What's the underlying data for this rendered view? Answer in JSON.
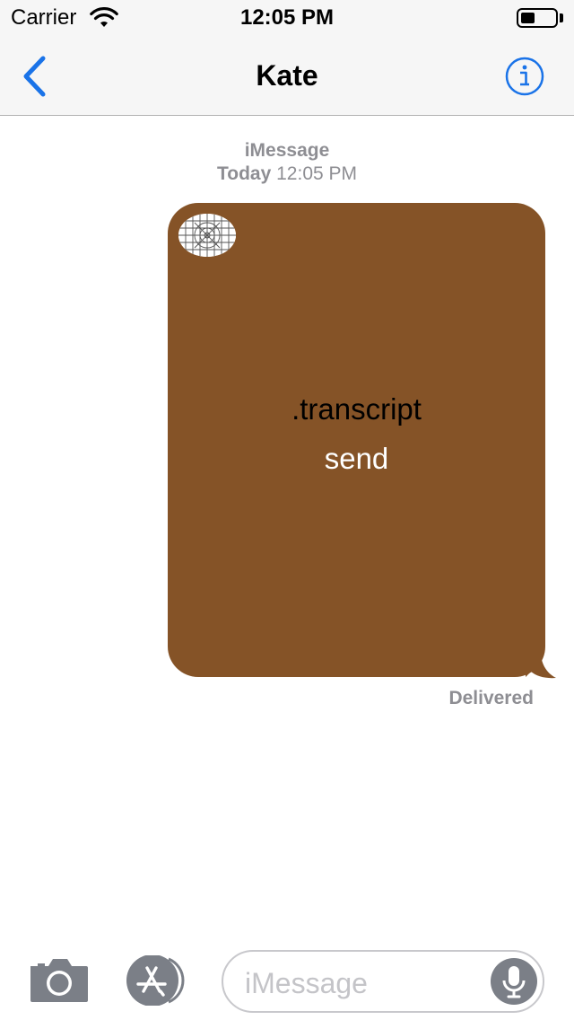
{
  "status_bar": {
    "carrier": "Carrier",
    "time": "12:05 PM",
    "battery_level": 0.4,
    "icons": [
      "wifi-icon",
      "battery-icon"
    ]
  },
  "nav": {
    "title": "Kate",
    "icons": [
      "chevron-left-icon",
      "info-icon"
    ]
  },
  "conversation": {
    "service": "iMessage",
    "day": "Today",
    "time": "12:05 PM",
    "messages": [
      {
        "direction": "outgoing",
        "bubble_color": "#855327",
        "line1": ".transcript",
        "line2": "send",
        "thumbnail_icon": "grid-pattern-icon"
      }
    ],
    "delivery_status": "Delivered"
  },
  "composer": {
    "placeholder": "iMessage",
    "icons": [
      "camera-icon",
      "app-store-icon",
      "microphone-icon"
    ]
  },
  "colors": {
    "accent": "#1a73e8",
    "bar_background": "#f6f6f6",
    "meta_text": "#8e8e93",
    "toolbar_icon": "#7b7f87"
  }
}
